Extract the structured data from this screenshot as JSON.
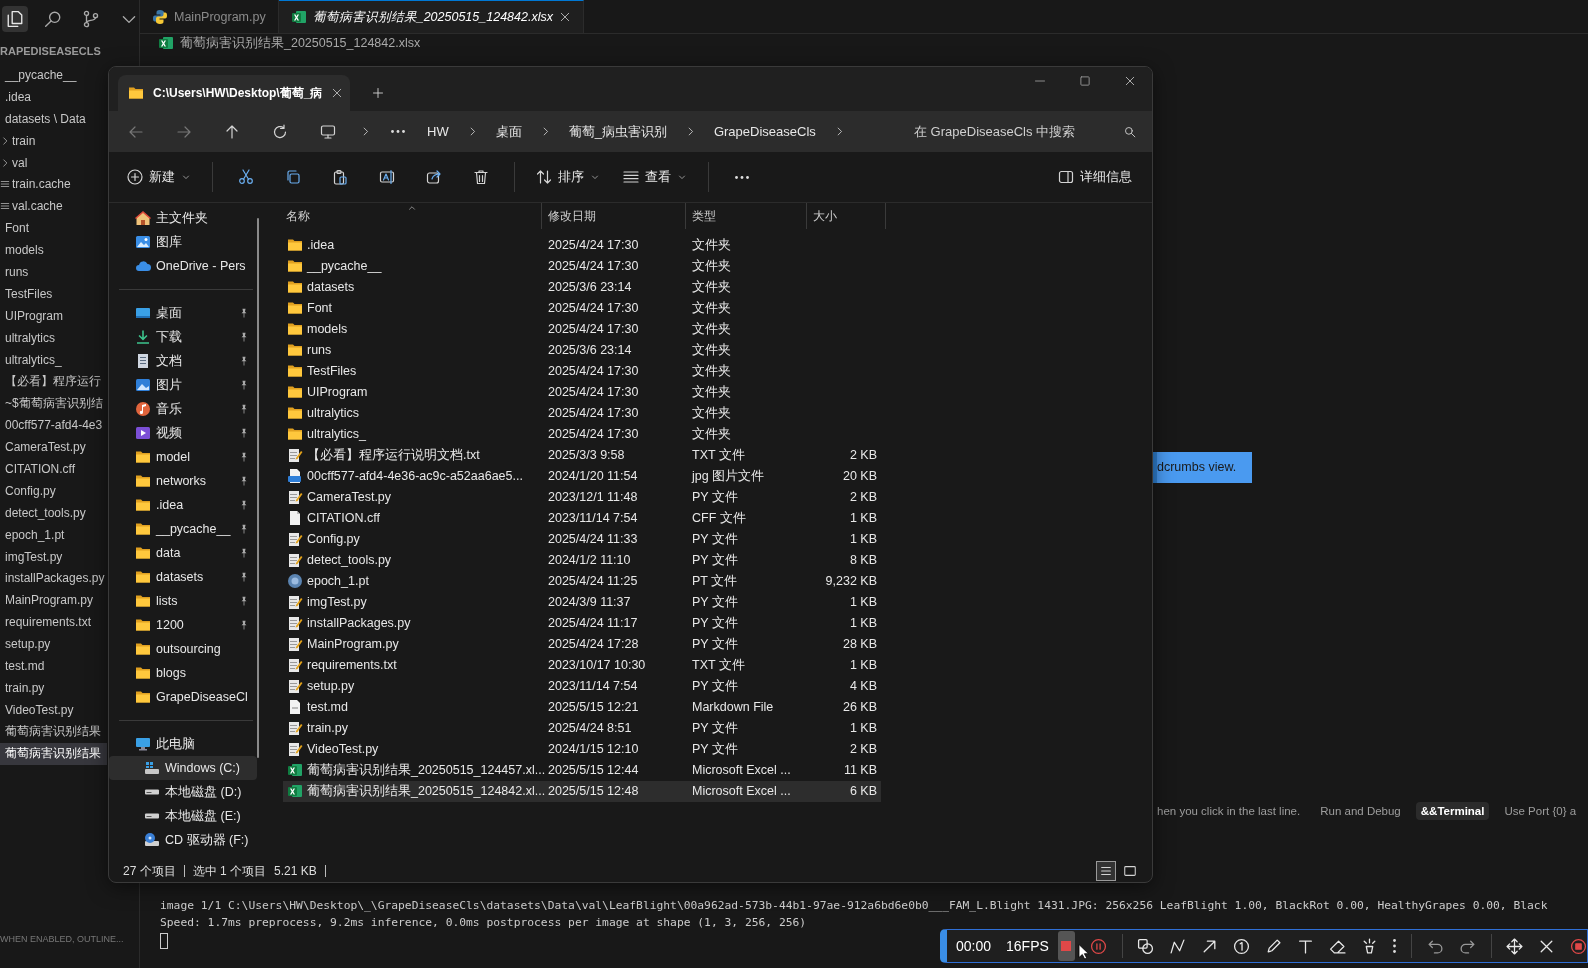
{
  "vscode": {
    "activity": [
      {
        "kind": "files",
        "selected": true
      },
      {
        "kind": "search",
        "selected": false
      },
      {
        "kind": "source-control",
        "selected": false
      },
      {
        "kind": "chevron",
        "selected": false
      }
    ],
    "explorer_title": "RAPEDISEASECLS",
    "tree": [
      {
        "label": "__pycache__",
        "selected": false
      },
      {
        "label": ".idea",
        "selected": false
      },
      {
        "label": "datasets \\ Data",
        "selected": false,
        "children": [
          {
            "label": "train",
            "kind": "chevron",
            "selected": false
          },
          {
            "label": "val",
            "kind": "chevron",
            "selected": false
          },
          {
            "label": "train.cache",
            "kind": "lines",
            "selected": false
          },
          {
            "label": "val.cache",
            "kind": "lines",
            "selected": false
          }
        ]
      },
      {
        "label": "Font",
        "selected": false
      },
      {
        "label": "models",
        "selected": false
      },
      {
        "label": "runs",
        "selected": false
      },
      {
        "label": "TestFiles",
        "selected": false
      },
      {
        "label": "UIProgram",
        "selected": false
      },
      {
        "label": "ultralytics",
        "selected": false
      },
      {
        "label": "ultralytics_",
        "selected": false
      },
      {
        "label": "【必看】程序运行",
        "selected": false
      },
      {
        "label": "~$葡萄病害识别结",
        "selected": false
      },
      {
        "label": "00cff577-afd4-4e3",
        "selected": false
      },
      {
        "label": "CameraTest.py",
        "selected": false
      },
      {
        "label": "CITATION.cff",
        "selected": false
      },
      {
        "label": "Config.py",
        "selected": false
      },
      {
        "label": "detect_tools.py",
        "selected": false
      },
      {
        "label": "epoch_1.pt",
        "selected": false
      },
      {
        "label": "imgTest.py",
        "selected": false
      },
      {
        "label": "installPackages.py",
        "selected": false
      },
      {
        "label": "MainProgram.py",
        "selected": false
      },
      {
        "label": "requirements.txt",
        "selected": false
      },
      {
        "label": "setup.py",
        "selected": false
      },
      {
        "label": "test.md",
        "selected": false
      },
      {
        "label": "train.py",
        "selected": false
      },
      {
        "label": "VideoTest.py",
        "selected": false
      },
      {
        "label": "葡萄病害识别结果",
        "selected": false
      },
      {
        "label": "葡萄病害识别结果",
        "selected": true
      }
    ],
    "outline_hint": "WHEN ENABLED, OUTLINE..."
  },
  "editor": {
    "tabs": [
      {
        "label": "MainProgram.py",
        "kind": "python",
        "selected": false
      },
      {
        "label": "葡萄病害识别结果_20250515_124842.xlsx",
        "kind": "excel",
        "selected": true
      }
    ],
    "breadcrumb": "葡萄病害识别结果_20250515_124842.xlsx",
    "tooltip": "dcrumbs view.",
    "hints": [
      {
        "label": "hen you click in the last line.",
        "selected": false
      },
      {
        "label": "Run and Debug",
        "selected": false
      },
      {
        "label": "&&Terminal",
        "selected": true
      },
      {
        "label": "Use Port {0} a",
        "selected": false
      }
    ]
  },
  "terminal": {
    "lines": [
      "image 1/1 C:\\Users\\HW\\Desktop\\_\\GrapeDiseaseCls\\datasets\\Data\\val\\LeafBlight\\00a962ad-573b-44b1-97ae-912a6bd6e0b0___FAM_L.Blight 1431.JPG: 256x256 LeafBlight 1.00, BlackRot 0.00, HealthyGrapes 0.00, Black",
      "Speed: 1.7ms preprocess, 9.2ms inference, 0.0ms postprocess per image at shape (1, 3, 256, 256)"
    ]
  },
  "file_explorer": {
    "tab": {
      "title": "C:\\Users\\HW\\Desktop\\葡萄_病"
    },
    "path": [
      "HW",
      "桌面",
      "葡萄_病虫害识别",
      "GrapeDiseaseCls"
    ],
    "search": {
      "placeholder": "在 GrapeDiseaseCls 中搜索"
    },
    "toolbar": [
      [
        {
          "kind": "new",
          "label": "新建"
        }
      ],
      [
        {
          "kind": "cut"
        },
        {
          "kind": "copy"
        },
        {
          "kind": "paste"
        },
        {
          "kind": "rename"
        },
        {
          "kind": "share"
        },
        {
          "kind": "delete"
        }
      ],
      [
        {
          "kind": "sort",
          "label": "排序"
        },
        {
          "kind": "view",
          "label": "查看"
        }
      ],
      [
        {
          "kind": "more"
        }
      ]
    ],
    "details": "详细信息",
    "nav": {
      "quick": [
        {
          "label": "主文件夹",
          "kind": "home",
          "selected": false
        },
        {
          "label": "图库",
          "kind": "gallery",
          "selected": false
        },
        {
          "label": "OneDrive - Pers",
          "kind": "cloud",
          "selected": false
        }
      ],
      "pinned": [
        {
          "label": "桌面",
          "kind": "desktop",
          "pinned": true,
          "selected": false
        },
        {
          "label": "下载",
          "kind": "download",
          "pinned": true,
          "selected": false
        },
        {
          "label": "文档",
          "kind": "docs",
          "pinned": true,
          "selected": false
        },
        {
          "label": "图片",
          "kind": "pictures",
          "pinned": true,
          "selected": false
        },
        {
          "label": "音乐",
          "kind": "music",
          "pinned": true,
          "selected": false
        },
        {
          "label": "视频",
          "kind": "video",
          "pinned": true,
          "selected": false
        },
        {
          "label": "model",
          "kind": "folder",
          "pinned": true,
          "selected": false
        },
        {
          "label": "networks",
          "kind": "folder",
          "pinned": true,
          "selected": false
        },
        {
          "label": ".idea",
          "kind": "folder",
          "pinned": true,
          "selected": false
        },
        {
          "label": "__pycache__",
          "kind": "folder",
          "pinned": true,
          "selected": false
        },
        {
          "label": "data",
          "kind": "folder",
          "pinned": true,
          "selected": false
        },
        {
          "label": "datasets",
          "kind": "folder",
          "pinned": true,
          "selected": false
        },
        {
          "label": "lists",
          "kind": "folder",
          "pinned": true,
          "selected": false
        },
        {
          "label": "1200",
          "kind": "folder",
          "pinned": true,
          "selected": false
        },
        {
          "label": "outsourcing",
          "kind": "folder",
          "pinned": false,
          "selected": false
        },
        {
          "label": "blogs",
          "kind": "folder",
          "pinned": false,
          "selected": false
        },
        {
          "label": "GrapeDiseaseCl",
          "kind": "folder",
          "pinned": false,
          "selected": false
        }
      ],
      "pc": {
        "label": "此电脑",
        "kind": "pc",
        "selected": false,
        "children": [
          {
            "label": "Windows (C:)",
            "kind": "drivec",
            "selected": true
          },
          {
            "label": "本地磁盘 (D:)",
            "kind": "drive",
            "selected": false
          },
          {
            "label": "本地磁盘 (E:)",
            "kind": "drive",
            "selected": false
          },
          {
            "label": "CD 驱动器 (F:)",
            "kind": "cd",
            "selected": false
          }
        ]
      }
    },
    "columns": [
      {
        "label": "名称",
        "sorted": true
      },
      {
        "label": "修改日期",
        "sorted": false
      },
      {
        "label": "类型",
        "sorted": false
      },
      {
        "label": "大小",
        "sorted": false
      }
    ],
    "rows": [
      {
        "name": ".idea",
        "date": "2025/4/24 17:30",
        "type": "文件夹",
        "kind": "folder",
        "selected": false
      },
      {
        "name": "__pycache__",
        "date": "2025/4/24 17:30",
        "type": "文件夹",
        "kind": "folder",
        "selected": false
      },
      {
        "name": "datasets",
        "date": "2025/3/6 23:14",
        "type": "文件夹",
        "kind": "folder",
        "selected": false
      },
      {
        "name": "Font",
        "date": "2025/4/24 17:30",
        "type": "文件夹",
        "kind": "folder",
        "selected": false
      },
      {
        "name": "models",
        "date": "2025/4/24 17:30",
        "type": "文件夹",
        "kind": "folder",
        "selected": false
      },
      {
        "name": "runs",
        "date": "2025/3/6 23:14",
        "type": "文件夹",
        "kind": "folder",
        "selected": false
      },
      {
        "name": "TestFiles",
        "date": "2025/4/24 17:30",
        "type": "文件夹",
        "kind": "folder",
        "selected": false
      },
      {
        "name": "UIProgram",
        "date": "2025/4/24 17:30",
        "type": "文件夹",
        "kind": "folder",
        "selected": false
      },
      {
        "name": "ultralytics",
        "date": "2025/4/24 17:30",
        "type": "文件夹",
        "kind": "folder",
        "selected": false
      },
      {
        "name": "ultralytics_",
        "date": "2025/4/24 17:30",
        "type": "文件夹",
        "kind": "folder",
        "selected": false
      },
      {
        "name": "【必看】程序运行说明文档.txt",
        "date": "2025/3/3 9:58",
        "type": "TXT 文件",
        "size": "2 KB",
        "kind": "text",
        "selected": false
      },
      {
        "name": "00cff577-afd4-4e36-ac9c-a52aa6ae5...",
        "date": "2024/1/20 11:54",
        "type": "jpg 图片文件",
        "size": "20 KB",
        "kind": "image",
        "selected": false
      },
      {
        "name": "CameraTest.py",
        "date": "2023/12/1 11:48",
        "type": "PY 文件",
        "size": "2 KB",
        "kind": "text",
        "selected": false
      },
      {
        "name": "CITATION.cff",
        "date": "2023/11/14 7:54",
        "type": "CFF 文件",
        "size": "1 KB",
        "kind": "blank",
        "selected": false
      },
      {
        "name": "Config.py",
        "date": "2025/4/24 11:33",
        "type": "PY 文件",
        "size": "1 KB",
        "kind": "text",
        "selected": false
      },
      {
        "name": "detect_tools.py",
        "date": "2024/1/2 11:10",
        "type": "PY 文件",
        "size": "8 KB",
        "kind": "text",
        "selected": false
      },
      {
        "name": "epoch_1.pt",
        "date": "2025/4/24 11:25",
        "type": "PT 文件",
        "size": "9,232 KB",
        "kind": "circle",
        "selected": false
      },
      {
        "name": "imgTest.py",
        "date": "2024/3/9 11:37",
        "type": "PY 文件",
        "size": "1 KB",
        "kind": "text",
        "selected": false
      },
      {
        "name": "installPackages.py",
        "date": "2025/4/24 11:17",
        "type": "PY 文件",
        "size": "1 KB",
        "kind": "text",
        "selected": false
      },
      {
        "name": "MainProgram.py",
        "date": "2025/4/24 17:28",
        "type": "PY 文件",
        "size": "28 KB",
        "kind": "text",
        "selected": false
      },
      {
        "name": "requirements.txt",
        "date": "2023/10/17 10:30",
        "type": "TXT 文件",
        "size": "1 KB",
        "kind": "text",
        "selected": false
      },
      {
        "name": "setup.py",
        "date": "2023/11/14 7:54",
        "type": "PY 文件",
        "size": "4 KB",
        "kind": "text",
        "selected": false
      },
      {
        "name": "test.md",
        "date": "2025/5/15 12:21",
        "type": "Markdown File",
        "size": "26 KB",
        "kind": "markdown",
        "selected": false
      },
      {
        "name": "train.py",
        "date": "2025/4/24 8:51",
        "type": "PY 文件",
        "size": "1 KB",
        "kind": "text",
        "selected": false
      },
      {
        "name": "VideoTest.py",
        "date": "2024/1/15 12:10",
        "type": "PY 文件",
        "size": "2 KB",
        "kind": "text",
        "selected": false
      },
      {
        "name": "葡萄病害识别结果_20250515_124457.xl...",
        "date": "2025/5/15 12:44",
        "type": "Microsoft Excel ...",
        "size": "11 KB",
        "kind": "excel",
        "selected": false
      },
      {
        "name": "葡萄病害识别结果_20250515_124842.xl...",
        "date": "2025/5/15 12:48",
        "type": "Microsoft Excel ...",
        "size": "6 KB",
        "kind": "excel",
        "selected": true
      }
    ],
    "status": {
      "count": "27 个项目",
      "selection": "选中 1 个项目",
      "size": "5.21 KB"
    },
    "views": [
      {
        "kind": "details",
        "selected": true
      },
      {
        "kind": "tiles",
        "selected": false
      }
    ]
  },
  "recorder": {
    "time": "00:00",
    "fps": "16FPS"
  }
}
